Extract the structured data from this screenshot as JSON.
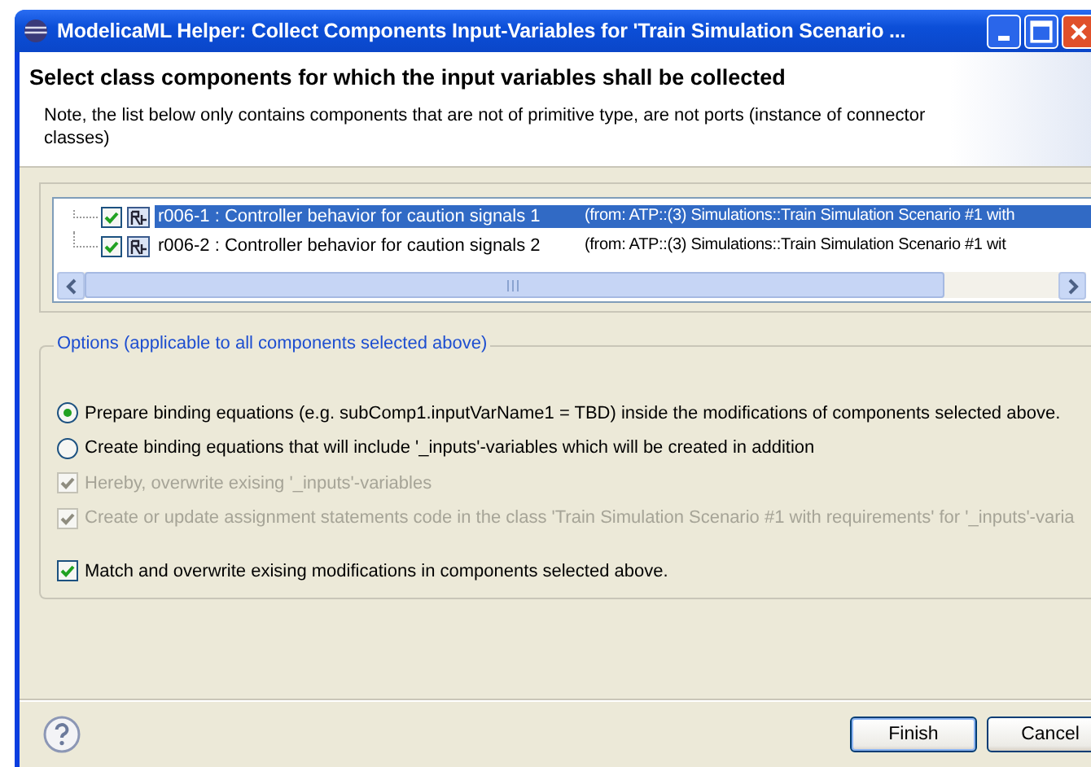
{
  "window": {
    "title": "ModelicaML Helper: Collect Components Input-Variables for 'Train Simulation Scenario ..."
  },
  "header": {
    "title": "Select class components for which the input variables shall be collected",
    "note": "Note, the list below only contains components that are not of primitive type, are not ports (instance of connector classes)"
  },
  "components": [
    {
      "name": "r006-1 : Controller behavior for caution signals 1",
      "source": "(from: ATP::(3) Simulations::Train Simulation Scenario #1 with",
      "checked": true,
      "selected": true
    },
    {
      "name": "r006-2 : Controller behavior for caution signals 2",
      "source": "(from: ATP::(3) Simulations::Train Simulation Scenario #1 wit",
      "checked": true,
      "selected": false
    }
  ],
  "options": {
    "legend": "Options (applicable to all components selected above)",
    "items": [
      {
        "kind": "radio",
        "label": "Prepare binding equations (e.g. subComp1.inputVarName1 = TBD) inside the modifications of components selected above.",
        "selected": true,
        "disabled": false
      },
      {
        "kind": "radio",
        "label": "Create binding equations that will include '_inputs'-variables which will be created in addition",
        "selected": false,
        "disabled": false
      },
      {
        "kind": "checkbox",
        "label": "Hereby, overwrite exising '_inputs'-variables",
        "checked": true,
        "disabled": true
      },
      {
        "kind": "checkbox",
        "label": "Create or update assignment statements code in the class 'Train Simulation Scenario #1 with requirements' for '_inputs'-varia",
        "checked": true,
        "disabled": true
      },
      {
        "kind": "checkbox",
        "label": "Match and overwrite exising modifications in components selected above.",
        "checked": true,
        "disabled": false
      }
    ]
  },
  "buttons": [
    "Finish",
    "Cancel"
  ]
}
